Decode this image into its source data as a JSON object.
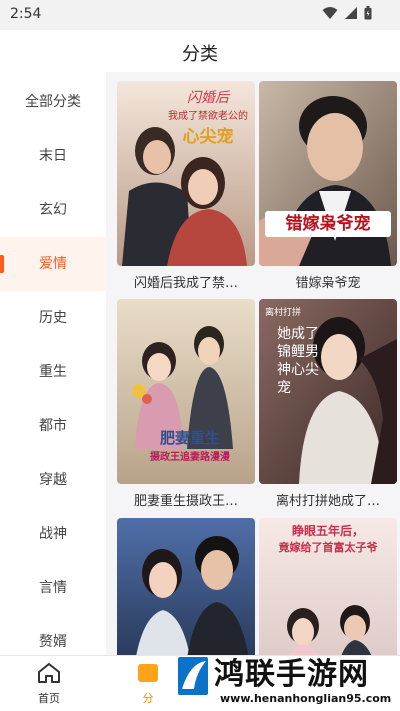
{
  "status": {
    "time": "2:54"
  },
  "header": {
    "title": "分类"
  },
  "sidebar": {
    "items": [
      {
        "label": "全部分类"
      },
      {
        "label": "末日"
      },
      {
        "label": "玄幻"
      },
      {
        "label": "爱情",
        "active": true
      },
      {
        "label": "历史"
      },
      {
        "label": "重生"
      },
      {
        "label": "都市"
      },
      {
        "label": "穿越"
      },
      {
        "label": "战神"
      },
      {
        "label": "言情"
      },
      {
        "label": "赘婿"
      }
    ]
  },
  "cards": [
    {
      "title": "闪婚后我成了禁…",
      "poster_text_1": "闪婚后",
      "poster_text_2": "我成了禁欲老公的",
      "poster_text_3": "心尖宠"
    },
    {
      "title": "错嫁枭爷宠",
      "poster_text_1": "错嫁枭爷宠"
    },
    {
      "title": "肥妻重生摄政王…",
      "poster_text_1": "肥妻重生",
      "poster_text_2": "摄政王追妻路漫漫"
    },
    {
      "title": "离村打拼她成了…",
      "poster_text_1": "离村打拼",
      "poster_text_2": "她成了锦鲤男神心尖宠"
    },
    {
      "title": "",
      "poster_text_1": ""
    },
    {
      "title": "",
      "poster_text_1": "睁眼五年后，",
      "poster_text_2": "竟嫁给了首富太子爷"
    }
  ],
  "tabbar": {
    "home_label": "首页",
    "category_label": "分"
  },
  "watermark": {
    "title": "鸿联手游网",
    "url": "www.henanhonglian95.com"
  },
  "colors": {
    "accent": "#ff5a1f",
    "tab_active": "#ff8a00"
  }
}
